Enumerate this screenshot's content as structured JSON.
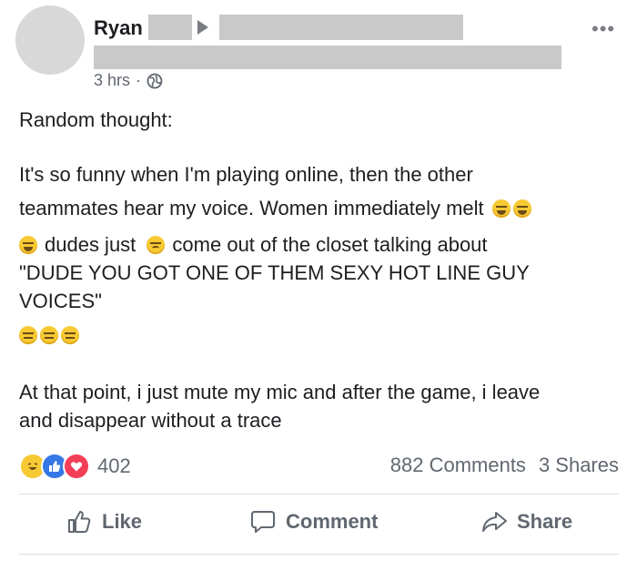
{
  "post": {
    "author_name": "Ryan",
    "timestamp": "3 hrs",
    "separator": "·",
    "privacy_icon": "globe-icon",
    "more_icon": "more-icon",
    "text": {
      "line1": "Random thought:",
      "line2": "It's so funny when I'm playing online, then the other",
      "line3": "teammates hear my voice. Women immediately melt",
      "line4a": "dudes just",
      "line4b": "come out of the closet talking about",
      "line5": "\"DUDE YOU GOT ONE OF THEM SEXY HOT LINE GUY",
      "line6": "VOICES\"",
      "line7": "At that point, i just mute my mic and after the game, i leave",
      "line8": "and disappear without a trace"
    },
    "reactions": {
      "types": [
        "haha",
        "like",
        "love"
      ],
      "count": "402"
    },
    "stats": {
      "comments": "882 Comments",
      "shares": "3 Shares"
    },
    "actions": {
      "like": "Like",
      "comment": "Comment",
      "share": "Share"
    },
    "colors": {
      "like_blue": "#3578e5",
      "love_red": "#f33e58",
      "haha_yellow": "#f7c933",
      "secondary_text": "#616770"
    }
  }
}
